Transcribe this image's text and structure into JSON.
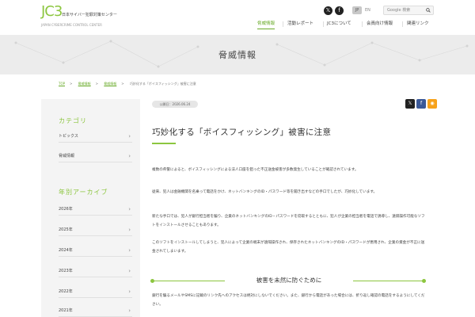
{
  "header": {
    "logo_mark": "JC3",
    "logo_name": "日本サイバー犯罪対策センター",
    "logo_sub": "JAPAN CYBERCRIME CONTROL CENTER",
    "lang_jp": "JP",
    "lang_en": "EN",
    "search_placeholder": "Google 検索",
    "nav": [
      {
        "label": "脅威情報",
        "active": true
      },
      {
        "label": "活動レポート",
        "active": false
      },
      {
        "label": "JC3について",
        "active": false
      },
      {
        "label": "会員向け情報",
        "active": false
      },
      {
        "label": "関連リンク",
        "active": false
      }
    ]
  },
  "banner": {
    "title": "脅威情報"
  },
  "breadcrumb": [
    "TOP",
    "脅威情報",
    "脅威情報",
    "巧妙化する「ボイスフィッシング」被害に注意"
  ],
  "sidebar": {
    "category_heading": "カテゴリ",
    "categories": [
      "トピックス",
      "脅威情報"
    ],
    "archive_heading": "年別アーカイブ",
    "years": [
      "2026年",
      "2025年",
      "2024年",
      "2023年",
      "2022年",
      "2021年"
    ]
  },
  "article": {
    "date": "公開日：2026.06.24",
    "title": "巧妙化する「ボイスフィッシング」被害に注意",
    "paragraphs": [
      "複数の県警によると、ボイスフィッシングによる法人口座を狙った不正送金被害が多数発生していることが確認されています。",
      "従来、犯人は金融機関を名乗って電話をかけ、ネットバンキングのID・パスワード等を聞き出すなどの手口でしたが、巧妙化しています。",
      "新たな手口では、犯人が銀行担当者を騙り、企業のネットバンキングのID・パスワードを窃取するとともに、犯人が企業の担当者を電話で誘導し、遠隔操作可能なソフトをインストールさせることもあります。",
      "このソフトをインストールしてしまうと、犯人によって企業の端末が遠隔操作され、保存されたネットバンキングのID・パスワードが悪用され、企業の資金が不正に送金されてしまいます。"
    ],
    "section_title": "被害を未然に防ぐために",
    "tail_paragraph": "銀行を騙るメールやSMSに記載のリンク先へのアクセスは絶対にしないでください。また、銀行から電話があった場合には、折り返し確認の電話をするようにしてください。"
  },
  "colors": {
    "accent": "#8cc63f",
    "banner": "#ececec",
    "sidebar": "#f4f4f4"
  }
}
